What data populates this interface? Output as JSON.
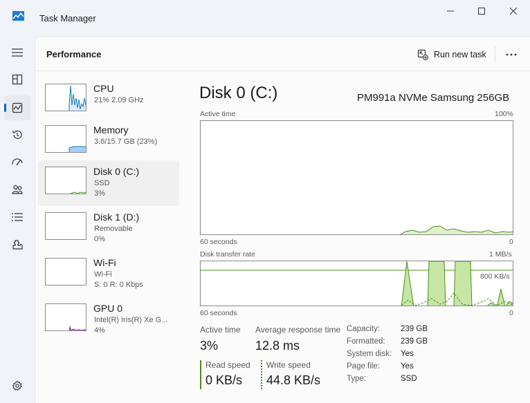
{
  "window": {
    "title": "Task Manager"
  },
  "header": {
    "title": "Performance",
    "run_new_task": "Run new task"
  },
  "devices": [
    {
      "name": "CPU",
      "line1": "21% 2.09 GHz",
      "line2": ""
    },
    {
      "name": "Memory",
      "line1": "3.6/15.7 GB (23%)",
      "line2": ""
    },
    {
      "name": "Disk 0 (C:)",
      "line1": "SSD",
      "line2": "3%"
    },
    {
      "name": "Disk 1 (D:)",
      "line1": "Removable",
      "line2": "0%"
    },
    {
      "name": "Wi-Fi",
      "line1": "Wi-Fi",
      "line2": "S: 0 R: 0 Kbps"
    },
    {
      "name": "GPU 0",
      "line1": "Intel(R) Iris(R) Xe G...",
      "line2": "4%"
    }
  ],
  "detail": {
    "title": "Disk 0 (C:)",
    "model": "PM991a NVMe Samsung 256GB",
    "active_time_graph": {
      "label": "Active time",
      "max": "100%",
      "xlabel_left": "60 seconds",
      "xlabel_right": "0"
    },
    "transfer_graph": {
      "label": "Disk transfer rate",
      "max": "1 MB/s",
      "mid": "800 KB/s",
      "xlabel_left": "60 seconds",
      "xlabel_right": "0"
    },
    "stats": {
      "active_time_label": "Active time",
      "active_time_value": "3%",
      "avg_response_label": "Average response time",
      "avg_response_value": "12.8 ms",
      "read_label": "Read speed",
      "read_value": "0 KB/s",
      "write_label": "Write speed",
      "write_value": "44.8 KB/s"
    },
    "properties": [
      {
        "label": "Capacity:",
        "value": "239 GB"
      },
      {
        "label": "Formatted:",
        "value": "239 GB"
      },
      {
        "label": "System disk:",
        "value": "Yes"
      },
      {
        "label": "Page file:",
        "value": "Yes"
      },
      {
        "label": "Type:",
        "value": "SSD"
      }
    ]
  },
  "colors": {
    "disk_green": "#4c8c1a",
    "disk_fill": "#c5e6a4",
    "cpu_blue": "#117dbb",
    "mem_purple": "#8b12ae",
    "accent": "#0067c0"
  },
  "icons": [
    "app-icon",
    "minimize-icon",
    "maximize-icon",
    "close-icon",
    "hamburger-icon",
    "processes-icon",
    "performance-icon",
    "app-history-icon",
    "startup-icon",
    "users-icon",
    "details-icon",
    "services-icon",
    "settings-icon",
    "run-task-icon",
    "more-icon"
  ]
}
